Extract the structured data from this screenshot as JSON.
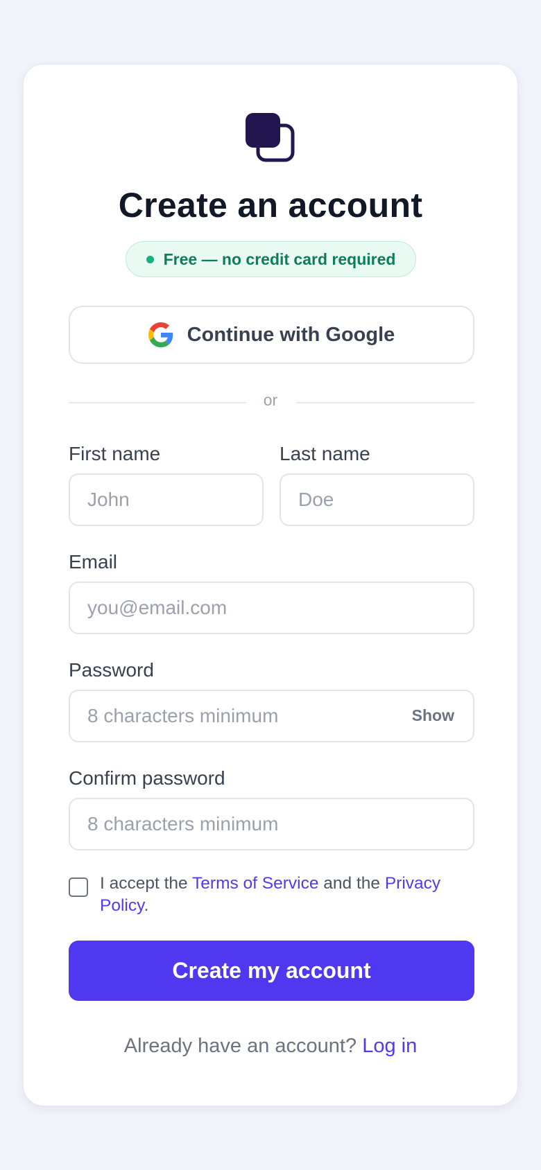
{
  "colors": {
    "accent": "#5037f0",
    "link": "#4f3ce8",
    "logo": "#231650",
    "badge_text": "#0f7d55",
    "badge_dot": "#10b57b"
  },
  "header": {
    "logo_icon": "stacked-squares-logo",
    "title": "Create an account",
    "badge": "Free — no credit card required"
  },
  "google_button": {
    "icon": "google-icon",
    "label": "Continue with Google"
  },
  "divider": {
    "text": "or"
  },
  "form": {
    "first_name": {
      "label": "First name",
      "placeholder": "John"
    },
    "last_name": {
      "label": "Last name",
      "placeholder": "Doe"
    },
    "email": {
      "label": "Email",
      "placeholder": "you@email.com"
    },
    "password": {
      "label": "Password",
      "placeholder": "8 characters minimum",
      "toggle_label": "Show"
    },
    "confirm_password": {
      "label": "Confirm password",
      "placeholder": "8 characters minimum"
    },
    "terms": {
      "checked": false,
      "prefix": "I accept the ",
      "tos_link": "Terms of Service",
      "middle": " and the ",
      "privacy_link": "Privacy Policy",
      "suffix": "."
    },
    "submit_label": "Create my account"
  },
  "footer": {
    "prompt": "Already have an account? ",
    "login_link": "Log in"
  }
}
